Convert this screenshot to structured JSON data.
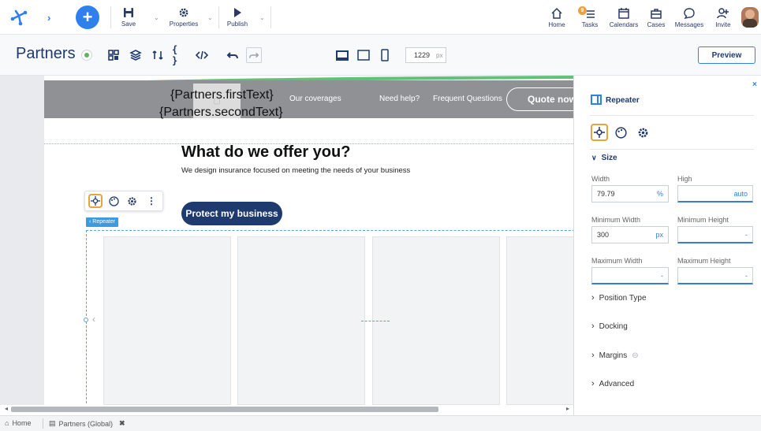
{
  "toolbar": {
    "save_label": "Save",
    "properties_label": "Properties",
    "publish_label": "Publish",
    "home_label": "Home",
    "tasks_label": "Tasks",
    "tasks_badge": "9",
    "calendars_label": "Calendars",
    "cases_label": "Cases",
    "messages_label": "Messages",
    "invite_label": "Invite"
  },
  "title": {
    "name": "Partners",
    "width_value": "1229",
    "width_unit": "px",
    "preview_label": "Preview"
  },
  "canvas": {
    "header_text_1": "{Partners.firstText}",
    "header_text_2": "{Partners.secondText}",
    "nav_coverages": "Our coverages",
    "nav_help": "Need help?",
    "nav_faq": "Frequent Questions",
    "quote_button": "Quote now",
    "heading": "What do we offer you?",
    "subheading": "We design insurance focused on meeting the needs of your business",
    "protect_button": "Protect my business",
    "repeater_tag": "‹ Repeater"
  },
  "panel": {
    "title": "Repeater",
    "size_section": "Size",
    "width_label": "Width",
    "width_value": "79.79",
    "width_unit": "%",
    "high_label": "High",
    "high_value": "auto",
    "min_width_label": "Minimum Width",
    "min_width_value": "300",
    "min_width_unit": "px",
    "min_height_label": "Minimum Height",
    "min_height_value": "-",
    "max_width_label": "Maximum Width",
    "max_width_value": "-",
    "max_height_label": "Maximum Height",
    "max_height_value": "-",
    "position_type": "Position Type",
    "docking": "Docking",
    "margins": "Margins",
    "advanced": "Advanced"
  },
  "bottom": {
    "home_tab": "Home",
    "partners_tab": "Partners (Global)"
  },
  "colors": {
    "accent_orange": "#e8a33d",
    "navy": "#1f3a6e",
    "brand_blue": "#2f80ed",
    "green_dot": "#5cb85c"
  }
}
